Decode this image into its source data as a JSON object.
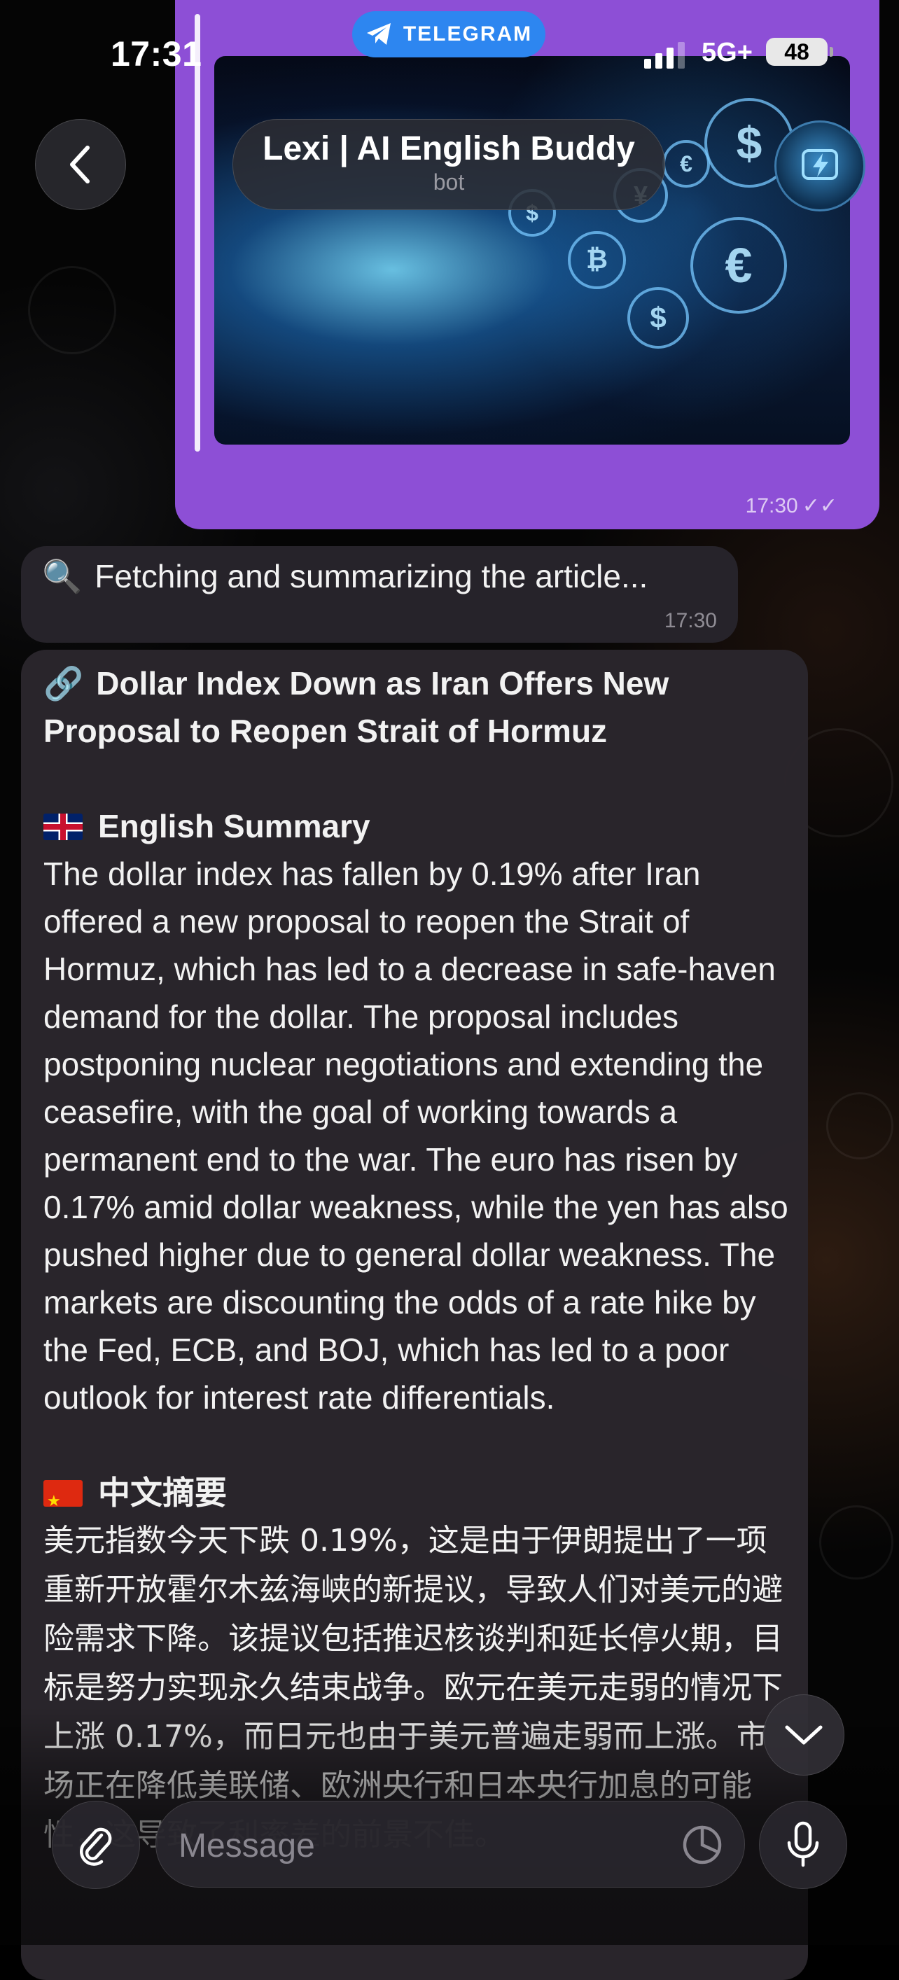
{
  "status_bar": {
    "time": "17:31",
    "app_pill": "TELEGRAM",
    "network": "5G+",
    "battery": "48"
  },
  "header": {
    "title": "Lexi | AI English Buddy",
    "subtitle": "bot"
  },
  "outgoing_message": {
    "time": "17:30",
    "image_icon": "currency-collage-image"
  },
  "messages": [
    {
      "icon": "🔍",
      "text": "Fetching and summarizing the article...",
      "time": "17:30"
    }
  ],
  "summary": {
    "link_icon": "🔗",
    "headline": "Dollar Index Down as Iran Offers New Proposal to Reopen Strait of Hormuz",
    "english_title": "English Summary",
    "english_body": "The dollar index has fallen by 0.19% after Iran offered a new proposal to reopen the Strait of Hormuz, which has led to a decrease in safe-haven demand for the dollar. The proposal includes postponing nuclear negotiations and extending the ceasefire, with the goal of working towards a permanent end to the war. The euro has risen by 0.17% amid dollar weakness, while the yen has also pushed higher due to general dollar weakness. The markets are discounting the odds of a rate hike by the Fed, ECB, and BOJ, which has led to a poor outlook for interest rate differentials.",
    "chinese_title": "中文摘要",
    "chinese_body": "美元指数今天下跌 0.19%，这是由于伊朗提出了一项重新开放霍尔木兹海峡的新提议，导致人们对美元的避险需求下降。该提议包括推迟核谈判和延长停火期，目标是努力实现永久结束战争。欧元在美元走弱的情况下上涨 0.17%，而日元也由于美元普遍走弱而上涨。市场正在降低美联储、欧洲央行和日本央行加息的可能性，这导致了利率差的前景不佳。"
  },
  "composer": {
    "placeholder": "Message"
  },
  "colors": {
    "outgoing_bubble": "#8d4fd6",
    "incoming_bubble": "#26232a",
    "telegram_pill": "#2d86f0"
  }
}
